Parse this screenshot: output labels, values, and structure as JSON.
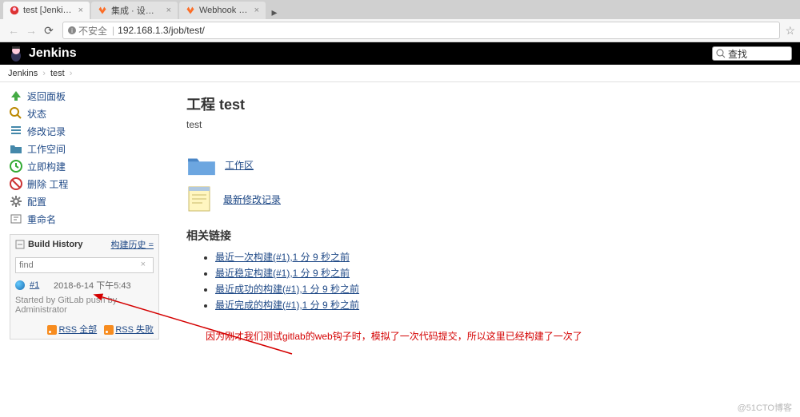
{
  "browser": {
    "tabs": [
      {
        "label": "test [Jenkins]",
        "active": true
      },
      {
        "label": "集成 · 设置 · Administr…",
        "active": false
      },
      {
        "label": "Webhook does not wo…",
        "active": false
      }
    ],
    "url_insecure": "不安全",
    "url": "192.168.1.3/job/test/"
  },
  "header": {
    "logo": "Jenkins",
    "search_placeholder": "查找"
  },
  "breadcrumb": {
    "items": [
      "Jenkins",
      "test"
    ]
  },
  "sidebar": {
    "items": [
      {
        "label": "返回面板"
      },
      {
        "label": "状态"
      },
      {
        "label": "修改记录"
      },
      {
        "label": "工作空间"
      },
      {
        "label": "立即构建"
      },
      {
        "label": "删除 工程"
      },
      {
        "label": "配置"
      },
      {
        "label": "重命名"
      }
    ]
  },
  "history": {
    "title": "Build History",
    "trend": "构建历史 =",
    "find_placeholder": "find",
    "builds": [
      {
        "num": "#1",
        "datetime": "2018-6-14 下午5:43"
      }
    ],
    "build_desc": "Started by GitLab push by Administrator",
    "rss_all": "RSS 全部",
    "rss_fail": "RSS 失败"
  },
  "main": {
    "heading": "工程 test",
    "desc": "test",
    "workspace_link": "工作区",
    "changes_link": "最新修改记录",
    "related_heading": "相关链接",
    "related": [
      "最近一次构建(#1),1 分 9 秒之前",
      "最近稳定构建(#1),1 分 9 秒之前",
      "最近成功的构建(#1),1 分 9 秒之前",
      "最近完成的构建(#1),1 分 9 秒之前"
    ],
    "annotation": "因为刚才我们测试gitlab的web钩子时，模拟了一次代码提交，所以这里已经构建了一次了"
  },
  "watermark": "@51CTO博客"
}
